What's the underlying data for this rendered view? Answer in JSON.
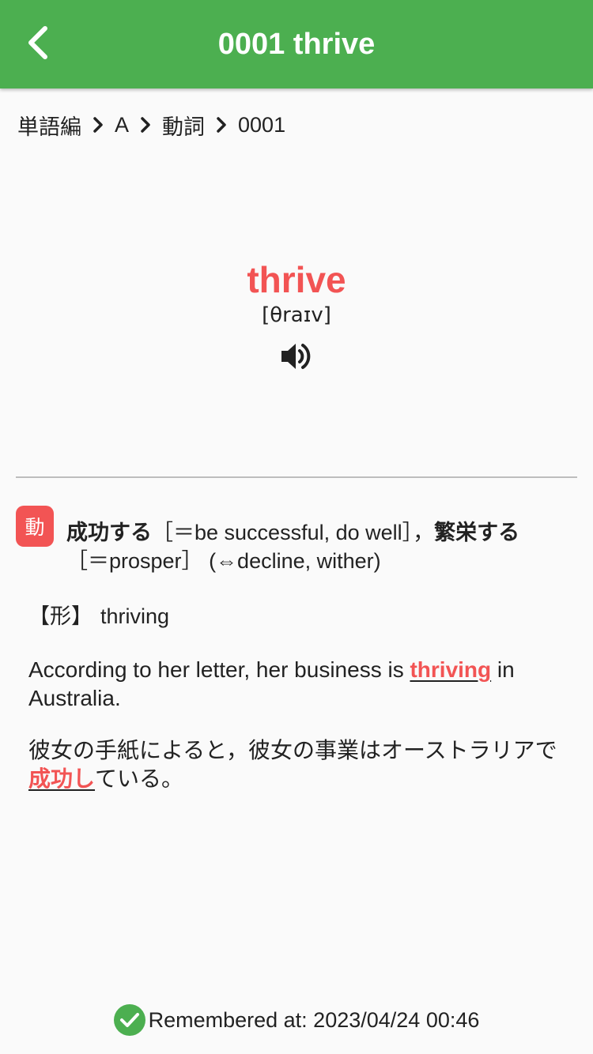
{
  "appbar": {
    "title": "0001 thrive",
    "back_icon": "chevron-left-icon",
    "color": "#4caf50"
  },
  "breadcrumb": {
    "items": [
      "単語編",
      "A",
      "動詞",
      "0001"
    ],
    "separator_icon": "chevron-right-icon"
  },
  "entry": {
    "word": "thrive",
    "ipa": "[θraɪv]",
    "speaker_icon": "speaker-icon",
    "accent": "#f25454"
  },
  "meaning": {
    "pos": "動",
    "sense1": "成功する",
    "gloss1": "［＝be successful, do well］，",
    "sense2": "繁栄する",
    "gloss2": "［＝prosper］",
    "antonyms": "(⇔decline, wither)"
  },
  "derived": {
    "tag": "【形】",
    "word": "thriving"
  },
  "example": {
    "en_before": "According to her letter, her business is ",
    "en_highlight": "thriving",
    "en_after": " in Australia.",
    "ja_before": "彼女の手紙によると，彼女の事業はオーストラリアで",
    "ja_highlight": "成功し",
    "ja_after": "ている。"
  },
  "footer": {
    "status_icon": "check-circle-icon",
    "remembered_text": "Remembered at: 2023/04/24 00:46"
  }
}
